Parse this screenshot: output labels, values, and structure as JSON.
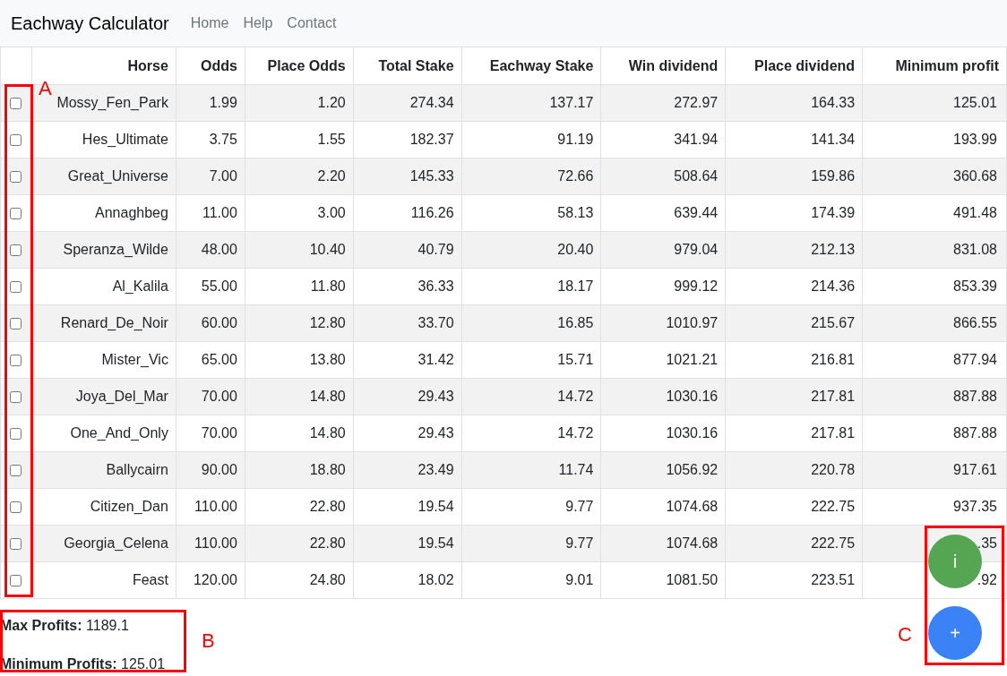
{
  "navbar": {
    "brand": "Eachway Calculator",
    "links": [
      "Home",
      "Help",
      "Contact"
    ]
  },
  "table": {
    "columns": [
      "Horse",
      "Odds",
      "Place Odds",
      "Total Stake",
      "Eachway Stake",
      "Win dividend",
      "Place dividend",
      "Minimum profit"
    ],
    "rows": [
      {
        "checked": false,
        "cells": [
          "Mossy_Fen_Park",
          "1.99",
          "1.20",
          "274.34",
          "137.17",
          "272.97",
          "164.33",
          "125.01"
        ]
      },
      {
        "checked": false,
        "cells": [
          "Hes_Ultimate",
          "3.75",
          "1.55",
          "182.37",
          "91.19",
          "341.94",
          "141.34",
          "193.99"
        ]
      },
      {
        "checked": false,
        "cells": [
          "Great_Universe",
          "7.00",
          "2.20",
          "145.33",
          "72.66",
          "508.64",
          "159.86",
          "360.68"
        ]
      },
      {
        "checked": false,
        "cells": [
          "Annaghbeg",
          "11.00",
          "3.00",
          "116.26",
          "58.13",
          "639.44",
          "174.39",
          "491.48"
        ]
      },
      {
        "checked": false,
        "cells": [
          "Speranza_Wilde",
          "48.00",
          "10.40",
          "40.79",
          "20.40",
          "979.04",
          "212.13",
          "831.08"
        ]
      },
      {
        "checked": false,
        "cells": [
          "Al_Kalila",
          "55.00",
          "11.80",
          "36.33",
          "18.17",
          "999.12",
          "214.36",
          "853.39"
        ]
      },
      {
        "checked": false,
        "cells": [
          "Renard_De_Noir",
          "60.00",
          "12.80",
          "33.70",
          "16.85",
          "1010.97",
          "215.67",
          "866.55"
        ]
      },
      {
        "checked": false,
        "cells": [
          "Mister_Vic",
          "65.00",
          "13.80",
          "31.42",
          "15.71",
          "1021.21",
          "216.81",
          "877.94"
        ]
      },
      {
        "checked": false,
        "cells": [
          "Joya_Del_Mar",
          "70.00",
          "14.80",
          "29.43",
          "14.72",
          "1030.16",
          "217.81",
          "887.88"
        ]
      },
      {
        "checked": false,
        "cells": [
          "One_And_Only",
          "70.00",
          "14.80",
          "29.43",
          "14.72",
          "1030.16",
          "217.81",
          "887.88"
        ]
      },
      {
        "checked": false,
        "cells": [
          "Ballycairn",
          "90.00",
          "18.80",
          "23.49",
          "11.74",
          "1056.92",
          "220.78",
          "917.61"
        ]
      },
      {
        "checked": false,
        "cells": [
          "Citizen_Dan",
          "110.00",
          "22.80",
          "19.54",
          "9.77",
          "1074.68",
          "222.75",
          "937.35"
        ]
      },
      {
        "checked": false,
        "cells": [
          "Georgia_Celena",
          "110.00",
          "22.80",
          "19.54",
          "9.77",
          "1074.68",
          "222.75",
          ".35"
        ]
      },
      {
        "checked": false,
        "cells": [
          "Feast",
          "120.00",
          "24.80",
          "18.02",
          "9.01",
          "1081.50",
          "223.51",
          ".92"
        ]
      }
    ]
  },
  "summary": [
    {
      "label": "Max Profits:",
      "value": "1189.1"
    },
    {
      "label": "Minimum Profits:",
      "value": "125.01"
    }
  ],
  "fab_buttons": [
    {
      "kind": "info",
      "label": "i"
    },
    {
      "kind": "add",
      "label": "+"
    }
  ],
  "annotations": [
    {
      "label": "A"
    },
    {
      "label": "B"
    },
    {
      "label": "C"
    }
  ]
}
